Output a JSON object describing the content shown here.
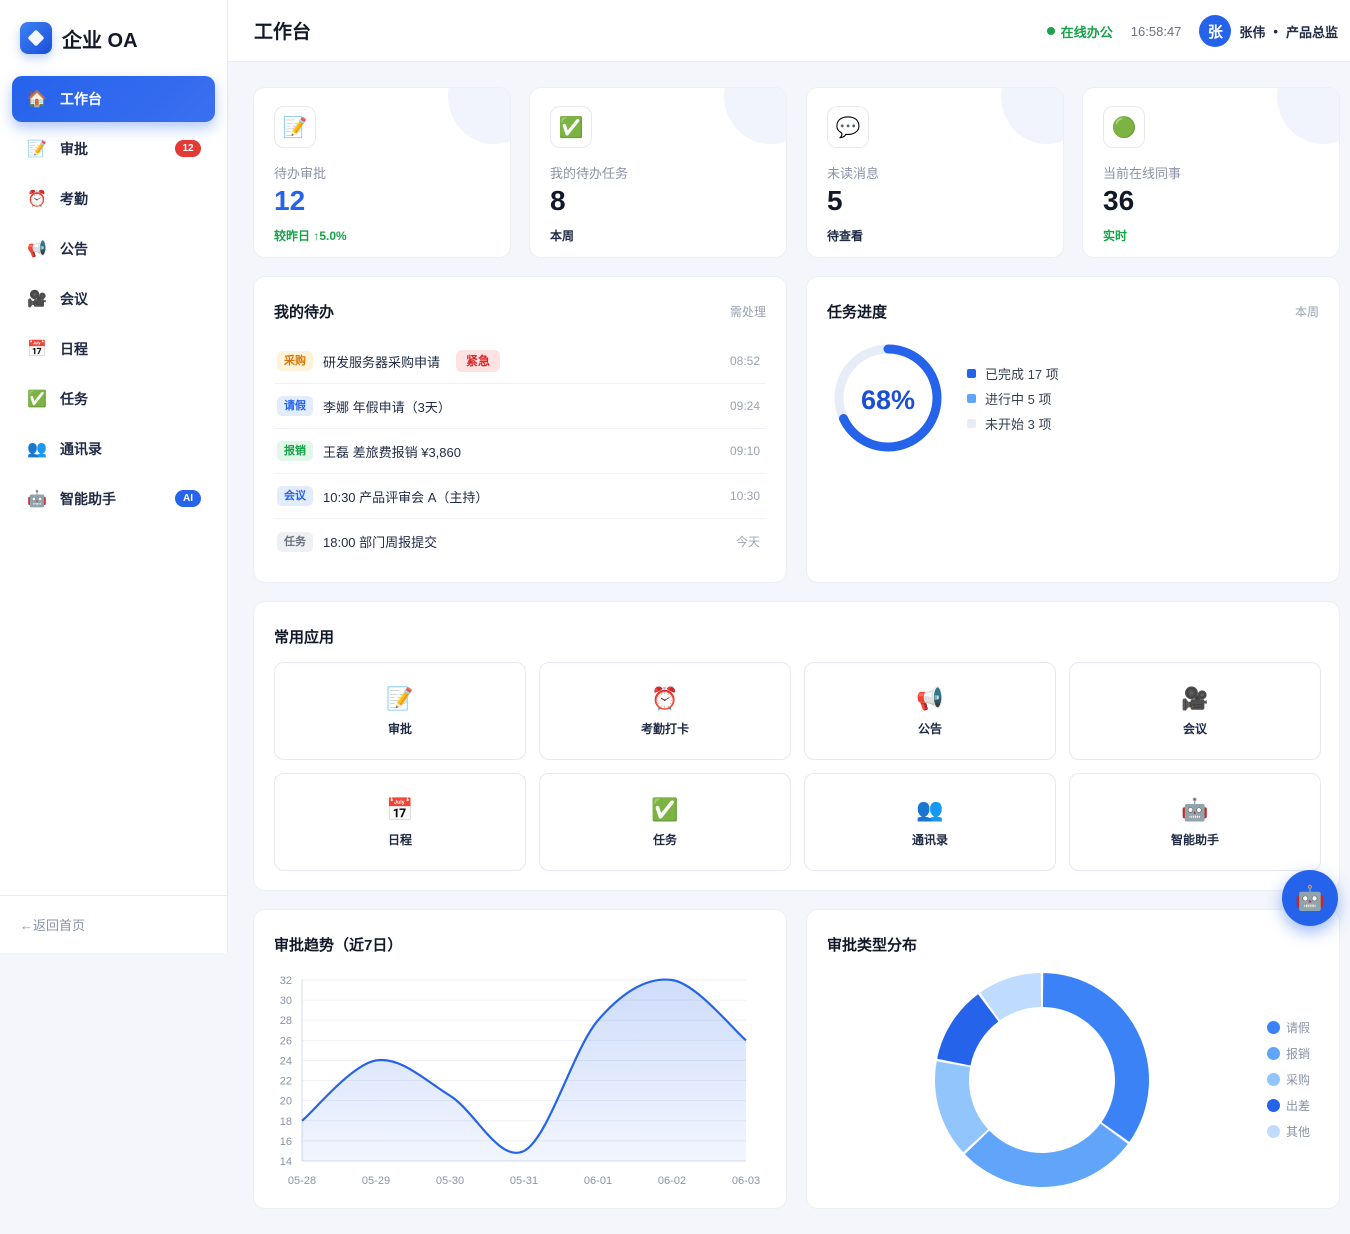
{
  "brand": {
    "title": "企业 OA"
  },
  "sidebar": {
    "items": [
      {
        "label": "工作台",
        "icon": "home-icon",
        "glyph": "🏠",
        "active": true,
        "badge": ""
      },
      {
        "label": "审批",
        "icon": "memo-icon",
        "glyph": "📝",
        "badge": "12"
      },
      {
        "label": "考勤",
        "icon": "alarm-clock-icon",
        "glyph": "⏰",
        "badge": ""
      },
      {
        "label": "公告",
        "icon": "megaphone-icon",
        "glyph": "📢",
        "badge": ""
      },
      {
        "label": "会议",
        "icon": "camera-icon",
        "glyph": "🎥",
        "badge": ""
      },
      {
        "label": "日程",
        "icon": "calendar-icon",
        "glyph": "📅",
        "badge": ""
      },
      {
        "label": "任务",
        "icon": "checkbox-icon",
        "glyph": "✅",
        "badge": ""
      },
      {
        "label": "通讯录",
        "icon": "contacts-icon",
        "glyph": "👥",
        "badge": ""
      },
      {
        "label": "智能助手",
        "icon": "robot-icon",
        "glyph": "🤖",
        "badge": "AI"
      }
    ],
    "back_label": "←返回首页"
  },
  "header": {
    "title": "工作台",
    "status": "在线办公",
    "time": "16:58:47",
    "avatar": "张",
    "user": "张伟",
    "dot": "•",
    "role": "产品总监"
  },
  "stats": [
    {
      "label": "待办审批",
      "value": "12",
      "sub": "较昨日 ↑5.0%",
      "icon": "memo-icon",
      "glyph": "📝"
    },
    {
      "label": "我的待办任务",
      "value": "8",
      "sub": "本周",
      "icon": "checkbox-icon",
      "glyph": "✅"
    },
    {
      "label": "未读消息",
      "value": "5",
      "sub": "待查看",
      "icon": "speech-bubble-icon",
      "glyph": "💬"
    },
    {
      "label": "当前在线同事",
      "value": "36",
      "sub": "实时",
      "icon": "green-circle-icon",
      "glyph": "🟢"
    }
  ],
  "todo": {
    "title": "我的待办",
    "extra": "需处理",
    "items": [
      {
        "tag": "采购",
        "text": "研发服务器采购申请",
        "urgent": "紧急",
        "time": "08:52"
      },
      {
        "tag": "请假",
        "text": "李娜 年假申请（3天）",
        "urgent": "",
        "time": "09:24"
      },
      {
        "tag": "报销",
        "text": "王磊 差旅费报销 ¥3,860",
        "urgent": "",
        "time": "09:10"
      },
      {
        "tag": "会议",
        "text": "10:30 产品评审会 A（主持）",
        "urgent": "",
        "time": "10:30"
      },
      {
        "tag": "任务",
        "text": "18:00 部门周报提交",
        "urgent": "",
        "time": "今天"
      }
    ]
  },
  "progress": {
    "title": "任务进度",
    "extra": "本周",
    "percent": "68%",
    "fraction": 0.68,
    "legend": [
      "已完成 17 项",
      "进行中 5 项",
      "未开始 3 项"
    ],
    "colors": [
      "#2563eb",
      "#60a5fa",
      "#e6ecf8"
    ]
  },
  "apps": {
    "title": "常用应用",
    "items": [
      {
        "label": "审批",
        "icon": "memo-icon",
        "glyph": "📝"
      },
      {
        "label": "考勤打卡",
        "icon": "alarm-clock-icon",
        "glyph": "⏰"
      },
      {
        "label": "公告",
        "icon": "megaphone-icon",
        "glyph": "📢"
      },
      {
        "label": "会议",
        "icon": "camera-icon",
        "glyph": "🎥"
      },
      {
        "label": "日程",
        "icon": "calendar-icon",
        "glyph": "📅"
      },
      {
        "label": "任务",
        "icon": "checkbox-icon",
        "glyph": "✅"
      },
      {
        "label": "通讯录",
        "icon": "contacts-icon",
        "glyph": "👥"
      },
      {
        "label": "智能助手",
        "icon": "robot-icon",
        "glyph": "🤖"
      }
    ]
  },
  "fab": {
    "icon": "robot-icon",
    "glyph": "🤖"
  },
  "chart_data": [
    {
      "type": "area",
      "title": "审批趋势（近7日）",
      "categories": [
        "05-28",
        "05-29",
        "05-30",
        "05-31",
        "06-01",
        "06-02",
        "06-03"
      ],
      "values": [
        18,
        24,
        20.5,
        15,
        28,
        32,
        26
      ],
      "ylim": [
        14,
        32
      ],
      "yticks": [
        "14",
        "16",
        "18",
        "20",
        "22",
        "24",
        "26",
        "28",
        "30",
        "32"
      ],
      "grid": true,
      "color": "#2563eb"
    },
    {
      "type": "pie",
      "title": "审批类型分布",
      "labels": [
        "请假",
        "报销",
        "采购",
        "出差",
        "其他"
      ],
      "values": [
        35,
        28,
        15,
        12,
        10
      ],
      "colors": [
        "#3b82f6",
        "#60a5fa",
        "#93c5fd",
        "#2563eb",
        "#bfdbfe"
      ],
      "legend": "right"
    }
  ]
}
